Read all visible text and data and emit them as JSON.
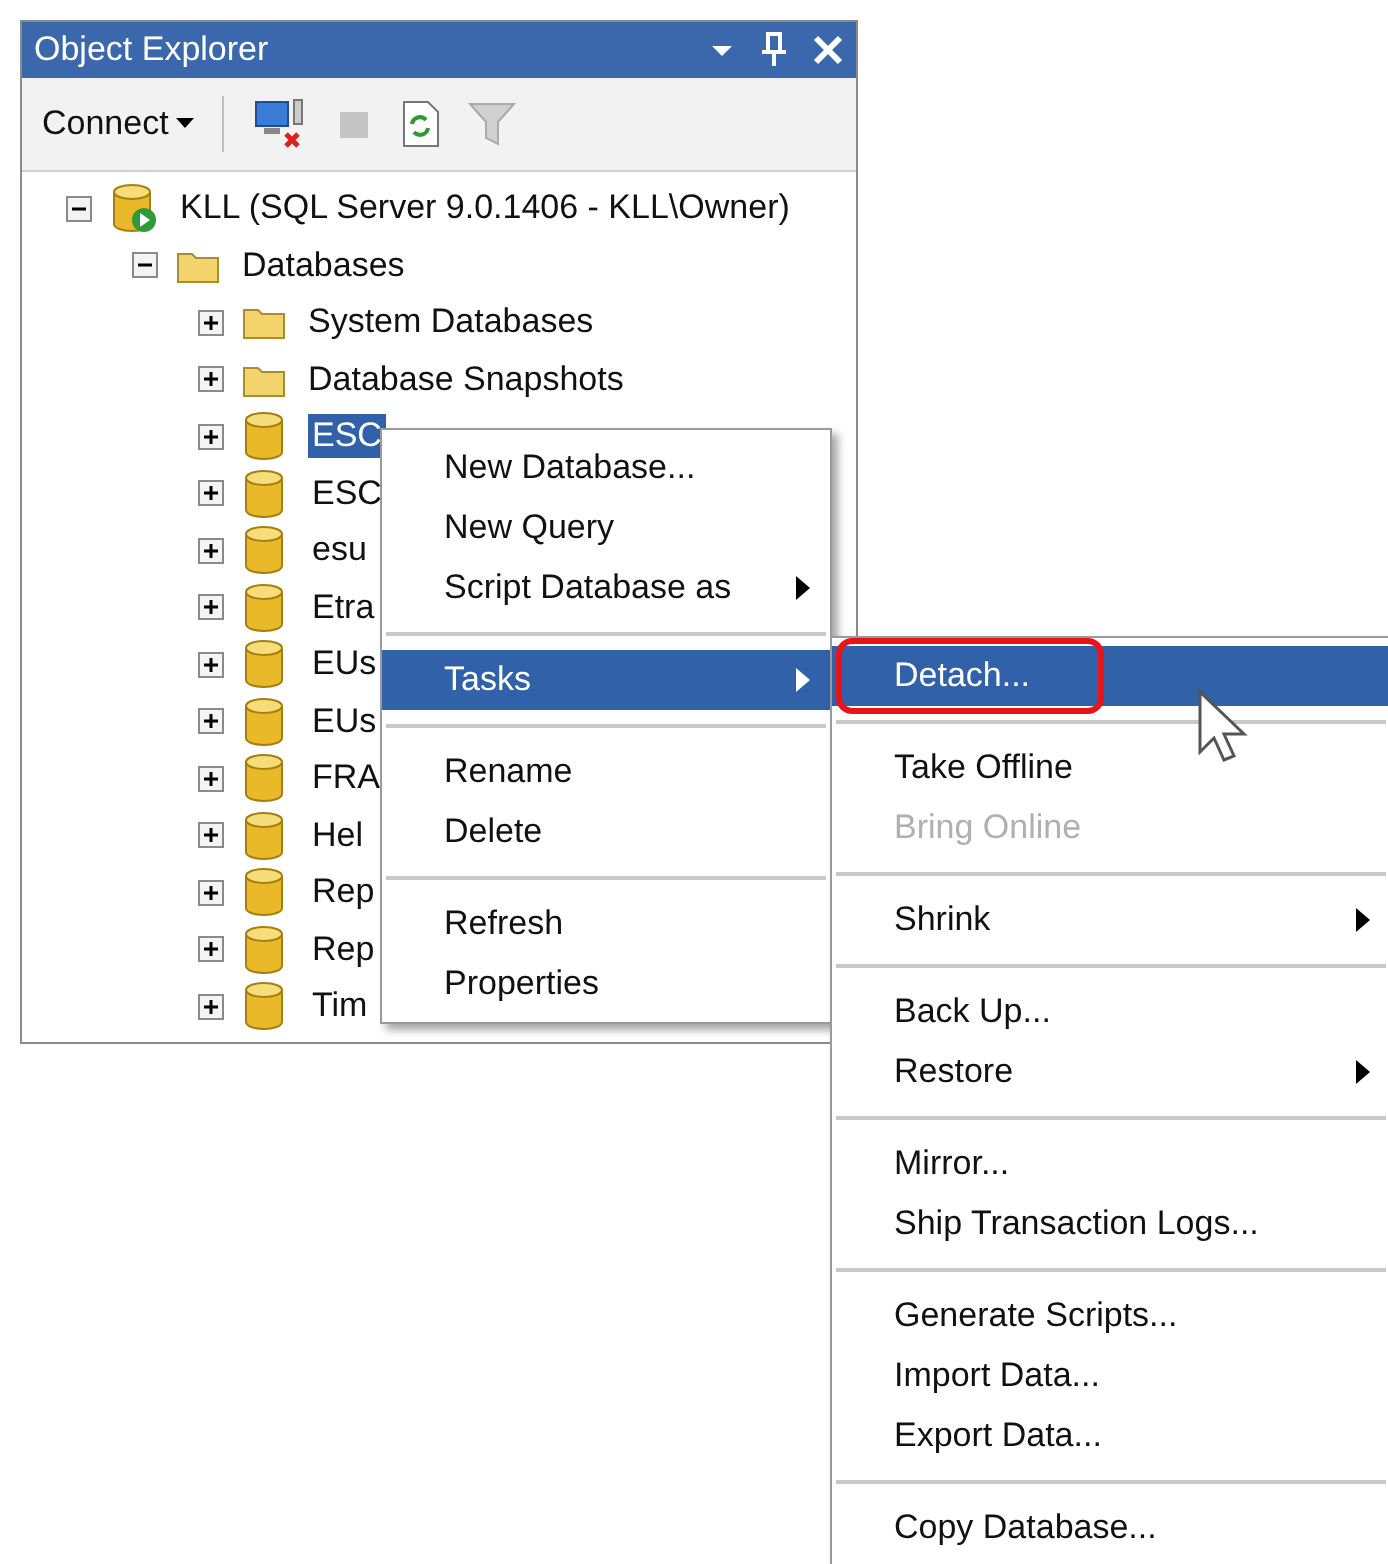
{
  "panel": {
    "title": "Object Explorer"
  },
  "toolbar": {
    "connect": "Connect"
  },
  "tree": [
    {
      "label": "KLL (SQL Server 9.0.1406 - KLL\\Owner)",
      "kind": "server",
      "expanded": true,
      "selected": false,
      "children": [
        {
          "label": "Databases",
          "kind": "folder",
          "expanded": true,
          "selected": false,
          "children": [
            {
              "label": "System Databases",
              "kind": "folder",
              "expanded": false,
              "selected": false
            },
            {
              "label": "Database Snapshots",
              "kind": "folder",
              "expanded": false,
              "selected": false
            },
            {
              "label": "ESC",
              "kind": "database",
              "expanded": false,
              "selected": true
            },
            {
              "label": "ESC",
              "kind": "database",
              "expanded": false,
              "selected": false
            },
            {
              "label": "esu",
              "kind": "database",
              "expanded": false,
              "selected": false
            },
            {
              "label": "Etra",
              "kind": "database",
              "expanded": false,
              "selected": false
            },
            {
              "label": "EUs",
              "kind": "database",
              "expanded": false,
              "selected": false
            },
            {
              "label": "EUs",
              "kind": "database",
              "expanded": false,
              "selected": false
            },
            {
              "label": "FRA",
              "kind": "database",
              "expanded": false,
              "selected": false
            },
            {
              "label": "Hel",
              "kind": "database",
              "expanded": false,
              "selected": false
            },
            {
              "label": "Rep",
              "kind": "database",
              "expanded": false,
              "selected": false
            },
            {
              "label": "Rep",
              "kind": "database",
              "expanded": false,
              "selected": false
            },
            {
              "label": "Tim",
              "kind": "database",
              "expanded": false,
              "selected": false
            }
          ]
        }
      ]
    }
  ],
  "context_menu": [
    {
      "kind": "item",
      "label": "New Database...",
      "submenu": false,
      "selected": false,
      "disabled": false
    },
    {
      "kind": "item",
      "label": "New Query",
      "submenu": false,
      "selected": false,
      "disabled": false
    },
    {
      "kind": "item",
      "label": "Script Database as",
      "submenu": true,
      "selected": false,
      "disabled": false
    },
    {
      "kind": "separator"
    },
    {
      "kind": "item",
      "label": "Tasks",
      "submenu": true,
      "selected": true,
      "disabled": false
    },
    {
      "kind": "separator"
    },
    {
      "kind": "item",
      "label": "Rename",
      "submenu": false,
      "selected": false,
      "disabled": false
    },
    {
      "kind": "item",
      "label": "Delete",
      "submenu": false,
      "selected": false,
      "disabled": false
    },
    {
      "kind": "separator"
    },
    {
      "kind": "item",
      "label": "Refresh",
      "submenu": false,
      "selected": false,
      "disabled": false
    },
    {
      "kind": "item",
      "label": "Properties",
      "submenu": false,
      "selected": false,
      "disabled": false
    }
  ],
  "tasks_submenu": [
    {
      "kind": "item",
      "label": "Detach...",
      "submenu": false,
      "selected": true,
      "disabled": false,
      "circled": true
    },
    {
      "kind": "separator"
    },
    {
      "kind": "item",
      "label": "Take Offline",
      "submenu": false,
      "selected": false,
      "disabled": false,
      "circled": false
    },
    {
      "kind": "item",
      "label": "Bring Online",
      "submenu": false,
      "selected": false,
      "disabled": true,
      "circled": false
    },
    {
      "kind": "separator"
    },
    {
      "kind": "item",
      "label": "Shrink",
      "submenu": true,
      "selected": false,
      "disabled": false,
      "circled": false
    },
    {
      "kind": "separator"
    },
    {
      "kind": "item",
      "label": "Back Up...",
      "submenu": false,
      "selected": false,
      "disabled": false,
      "circled": false
    },
    {
      "kind": "item",
      "label": "Restore",
      "submenu": true,
      "selected": false,
      "disabled": false,
      "circled": false
    },
    {
      "kind": "separator"
    },
    {
      "kind": "item",
      "label": "Mirror...",
      "submenu": false,
      "selected": false,
      "disabled": false,
      "circled": false
    },
    {
      "kind": "item",
      "label": "Ship Transaction Logs...",
      "submenu": false,
      "selected": false,
      "disabled": false,
      "circled": false
    },
    {
      "kind": "separator"
    },
    {
      "kind": "item",
      "label": "Generate Scripts...",
      "submenu": false,
      "selected": false,
      "disabled": false,
      "circled": false
    },
    {
      "kind": "item",
      "label": "Import Data...",
      "submenu": false,
      "selected": false,
      "disabled": false,
      "circled": false
    },
    {
      "kind": "item",
      "label": "Export Data...",
      "submenu": false,
      "selected": false,
      "disabled": false,
      "circled": false
    },
    {
      "kind": "separator"
    },
    {
      "kind": "item",
      "label": "Copy Database...",
      "submenu": false,
      "selected": false,
      "disabled": false,
      "circled": false
    }
  ]
}
